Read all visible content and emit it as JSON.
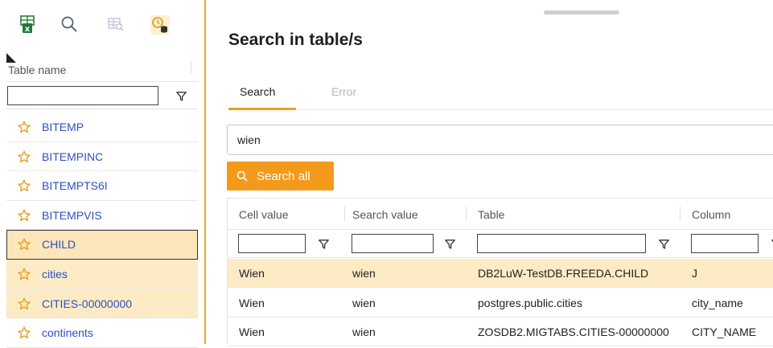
{
  "toolbar": {
    "icons": [
      "export-excel-icon",
      "search-icon",
      "table-search-icon",
      "history-database-icon"
    ]
  },
  "left": {
    "column_header": "Table name",
    "filter_value": "",
    "rows": [
      {
        "name": "BITEMP",
        "state": "normal"
      },
      {
        "name": "BITEMPINC",
        "state": "normal"
      },
      {
        "name": "BITEMPTS6I",
        "state": "normal"
      },
      {
        "name": "BITEMPVIS",
        "state": "normal"
      },
      {
        "name": "CHILD",
        "state": "selected"
      },
      {
        "name": "cities",
        "state": "highlighted"
      },
      {
        "name": "CITIES-00000000",
        "state": "highlighted"
      },
      {
        "name": "continents",
        "state": "normal"
      }
    ]
  },
  "dialog": {
    "title": "Search in table/s",
    "tabs": [
      {
        "label": "Search",
        "active": true
      },
      {
        "label": "Error",
        "active": false
      }
    ],
    "search_value": "wien",
    "search_button": "Search all",
    "grid": {
      "columns": [
        "Cell value",
        "Search value",
        "Table",
        "Column"
      ],
      "rows": [
        {
          "cells": [
            "Wien",
            "wien",
            "DB2LuW-TestDB.FREEDA.CHILD",
            "J"
          ],
          "highlighted": true
        },
        {
          "cells": [
            "Wien",
            "wien",
            "postgres.public.cities",
            "city_name"
          ],
          "highlighted": false
        },
        {
          "cells": [
            "Wien",
            "wien",
            "ZOSDB2.MIGTABS.CITIES-00000000",
            "CITY_NAME"
          ],
          "highlighted": false
        }
      ]
    }
  },
  "colors": {
    "accent": "#f39a1b",
    "row_highlight": "#fdebc6",
    "link_blue": "#2f4fbf",
    "star_orange": "#e6a21c"
  }
}
